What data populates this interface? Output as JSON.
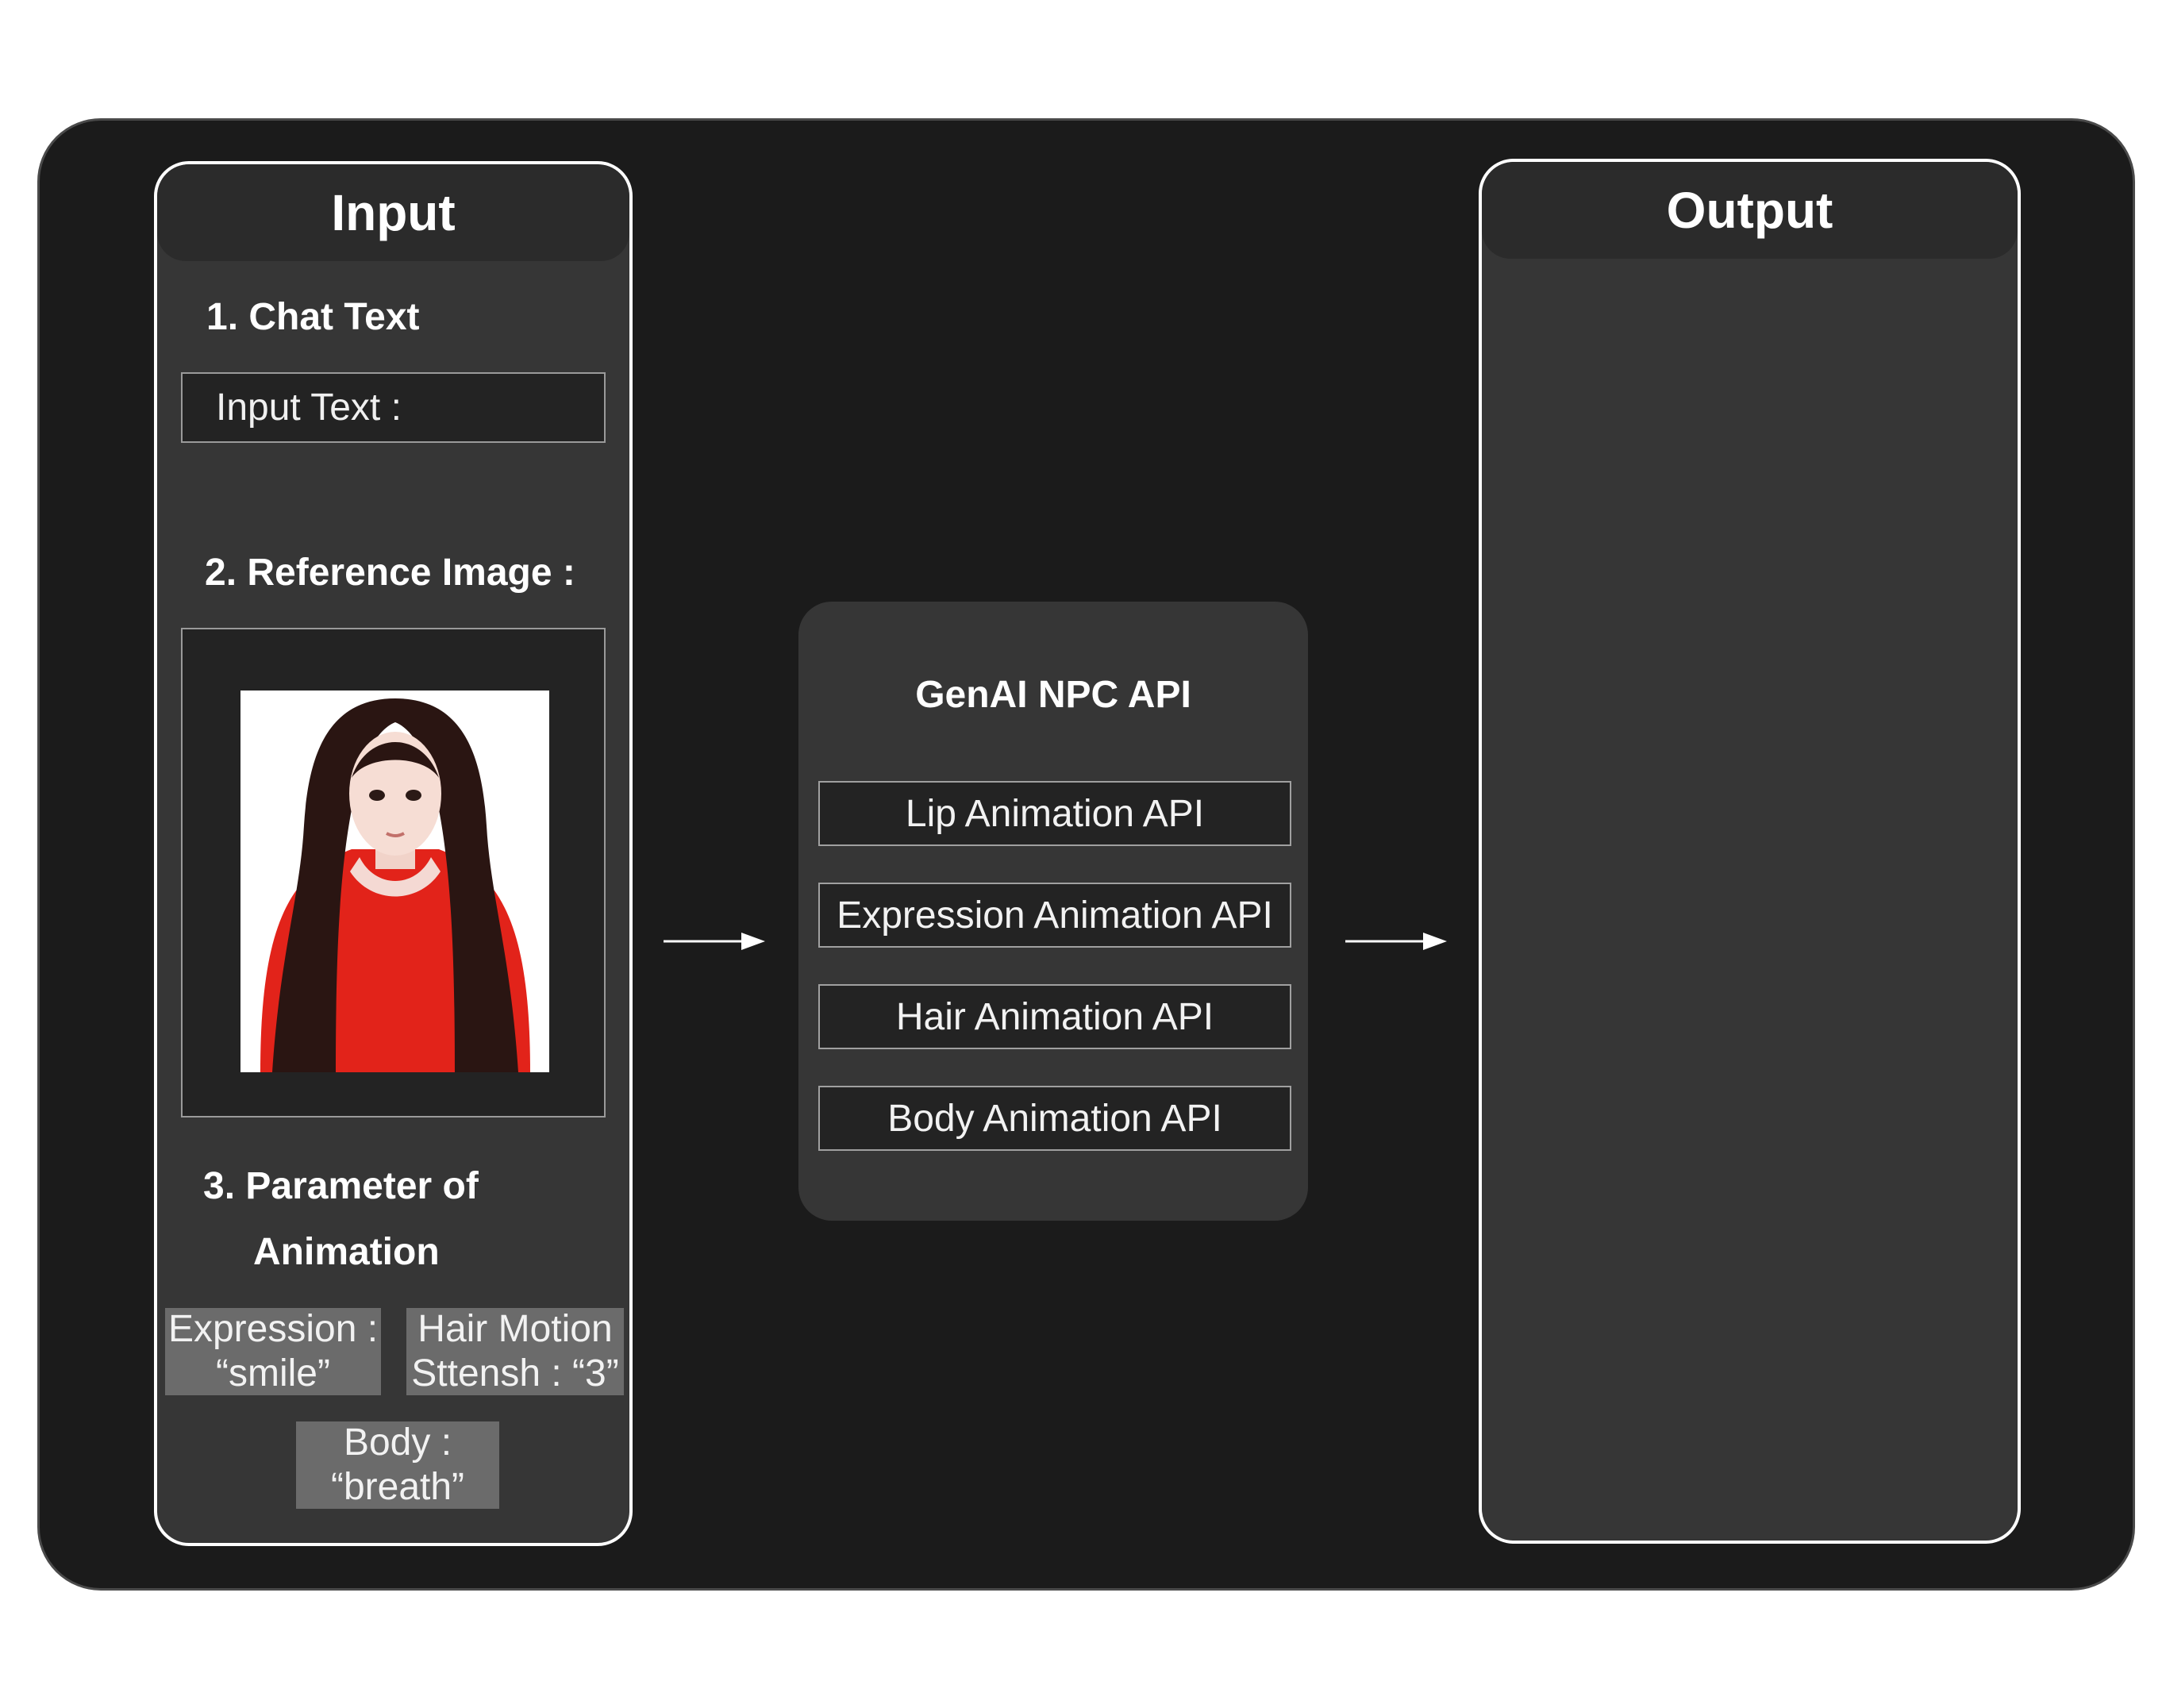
{
  "input": {
    "title": "Input",
    "chat_text_heading": "1. Chat Text",
    "input_text_label": "Input Text :",
    "reference_image_heading": "2. Reference Image :",
    "parameter_heading_line1": "3. Parameter of",
    "parameter_heading_line2": "Animation",
    "params": {
      "expression": "Expression :\n“smile”",
      "hair_motion": "Hair Motion\nSttensh : “3”",
      "body": "Body :\n“breath”"
    }
  },
  "api": {
    "title": "GenAI NPC API",
    "items": [
      "Lip Animation API",
      "Expression Animation API",
      "Hair Animation API",
      "Body Animation API"
    ]
  },
  "output": {
    "title": "Output"
  },
  "colors": {
    "frame": "#1b1b1b",
    "panel": "#363636",
    "header": "#2b2b2b",
    "tag": "#6b6b6b",
    "dress": "#e2231a",
    "hair": "#2a1512"
  }
}
